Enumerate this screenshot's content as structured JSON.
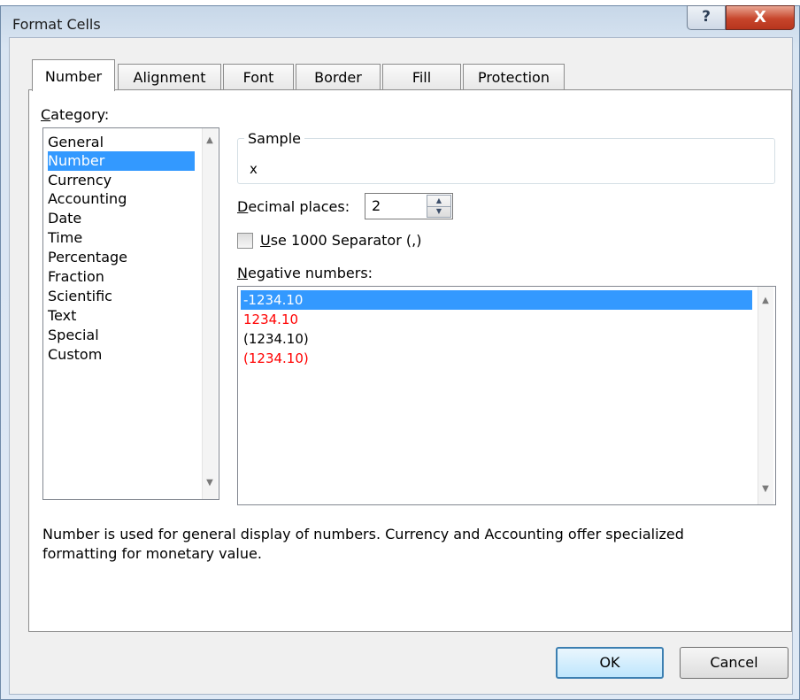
{
  "window": {
    "title": "Format Cells",
    "help_label": "?",
    "close_label": "X"
  },
  "tabs": [
    {
      "label": "Number",
      "active": true
    },
    {
      "label": "Alignment",
      "active": false
    },
    {
      "label": "Font",
      "active": false
    },
    {
      "label": "Border",
      "active": false
    },
    {
      "label": "Fill",
      "active": false
    },
    {
      "label": "Protection",
      "active": false
    }
  ],
  "category": {
    "label_u": "C",
    "label_rest": "ategory:",
    "items": [
      "General",
      "Number",
      "Currency",
      "Accounting",
      "Date",
      "Time",
      "Percentage",
      "Fraction",
      "Scientific",
      "Text",
      "Special",
      "Custom"
    ],
    "selected": "Number"
  },
  "sample": {
    "label": "Sample",
    "value": "x"
  },
  "decimal": {
    "label_u": "D",
    "label_rest": "ecimal places:",
    "value": "2"
  },
  "separator": {
    "label_u": "U",
    "label_rest": "se 1000 Separator (,)",
    "checked": false
  },
  "negative": {
    "label_u": "N",
    "label_rest": "egative numbers:",
    "items": [
      {
        "text": "-1234.10",
        "color": "#000000"
      },
      {
        "text": "1234.10",
        "color": "#ff0000"
      },
      {
        "text": "(1234.10)",
        "color": "#000000"
      },
      {
        "text": "(1234.10)",
        "color": "#ff0000"
      }
    ],
    "selected_index": 0
  },
  "description": {
    "line1": "Number is used for general display of numbers.  Currency and Accounting offer specialized",
    "line2": "formatting for monetary value."
  },
  "buttons": {
    "ok": "OK",
    "cancel": "Cancel"
  },
  "colors": {
    "selection": "#3399ff",
    "negative_red": "#ff0000"
  }
}
